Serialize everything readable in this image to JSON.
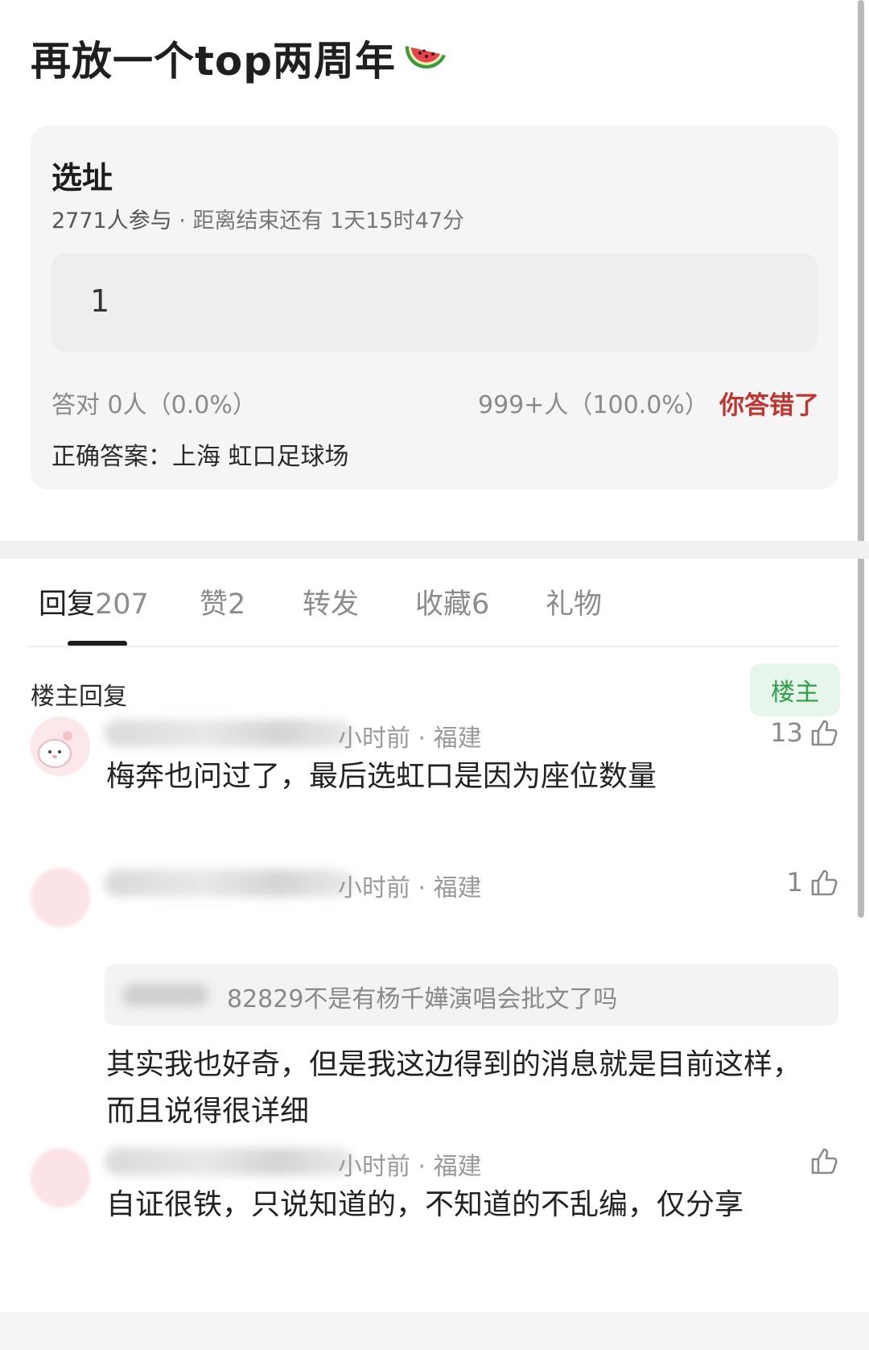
{
  "post": {
    "title": "再放一个top两周年"
  },
  "quiz": {
    "heading": "选址",
    "participants": "2771人参与",
    "separator": " · ",
    "countdown": "距离结束还有 1天15时47分",
    "option": "1",
    "correct_stats": "答对  0人（0.0%）",
    "wrong_stats": "999+人（100.0%）",
    "result": "你答错了",
    "answer": "正确答案：上海 虹口足球场",
    "correct_percent": 0.0,
    "wrong_percent": 100.0
  },
  "tabs": [
    {
      "label": "回复",
      "count": "207"
    },
    {
      "label": "赞",
      "count": "2"
    },
    {
      "label": "转发",
      "count": ""
    },
    {
      "label": "收藏",
      "count": "6"
    },
    {
      "label": "礼物",
      "count": ""
    }
  ],
  "filter": {
    "label": "楼主回复",
    "badge": "楼主"
  },
  "comments": [
    {
      "meta": "小时前 · 福建",
      "likes": "13",
      "text": "梅奔也问过了，最后选虹口是因为座位数量"
    },
    {
      "meta": "小时前 · 福建",
      "likes": "1",
      "quote": "82829不是有杨千嬅演唱会批文了吗",
      "text": "其实我也好奇，但是我这边得到的消息就是目前这样，而且说得很详细"
    },
    {
      "meta": "小时前 · 福建",
      "likes": "",
      "text": "自证很铁，只说知道的，不知道的不乱编，仅分享"
    }
  ],
  "colors": {
    "error": "#c0352f",
    "owner_green": "#2f9e48",
    "card_bg": "#f5f5f5"
  }
}
